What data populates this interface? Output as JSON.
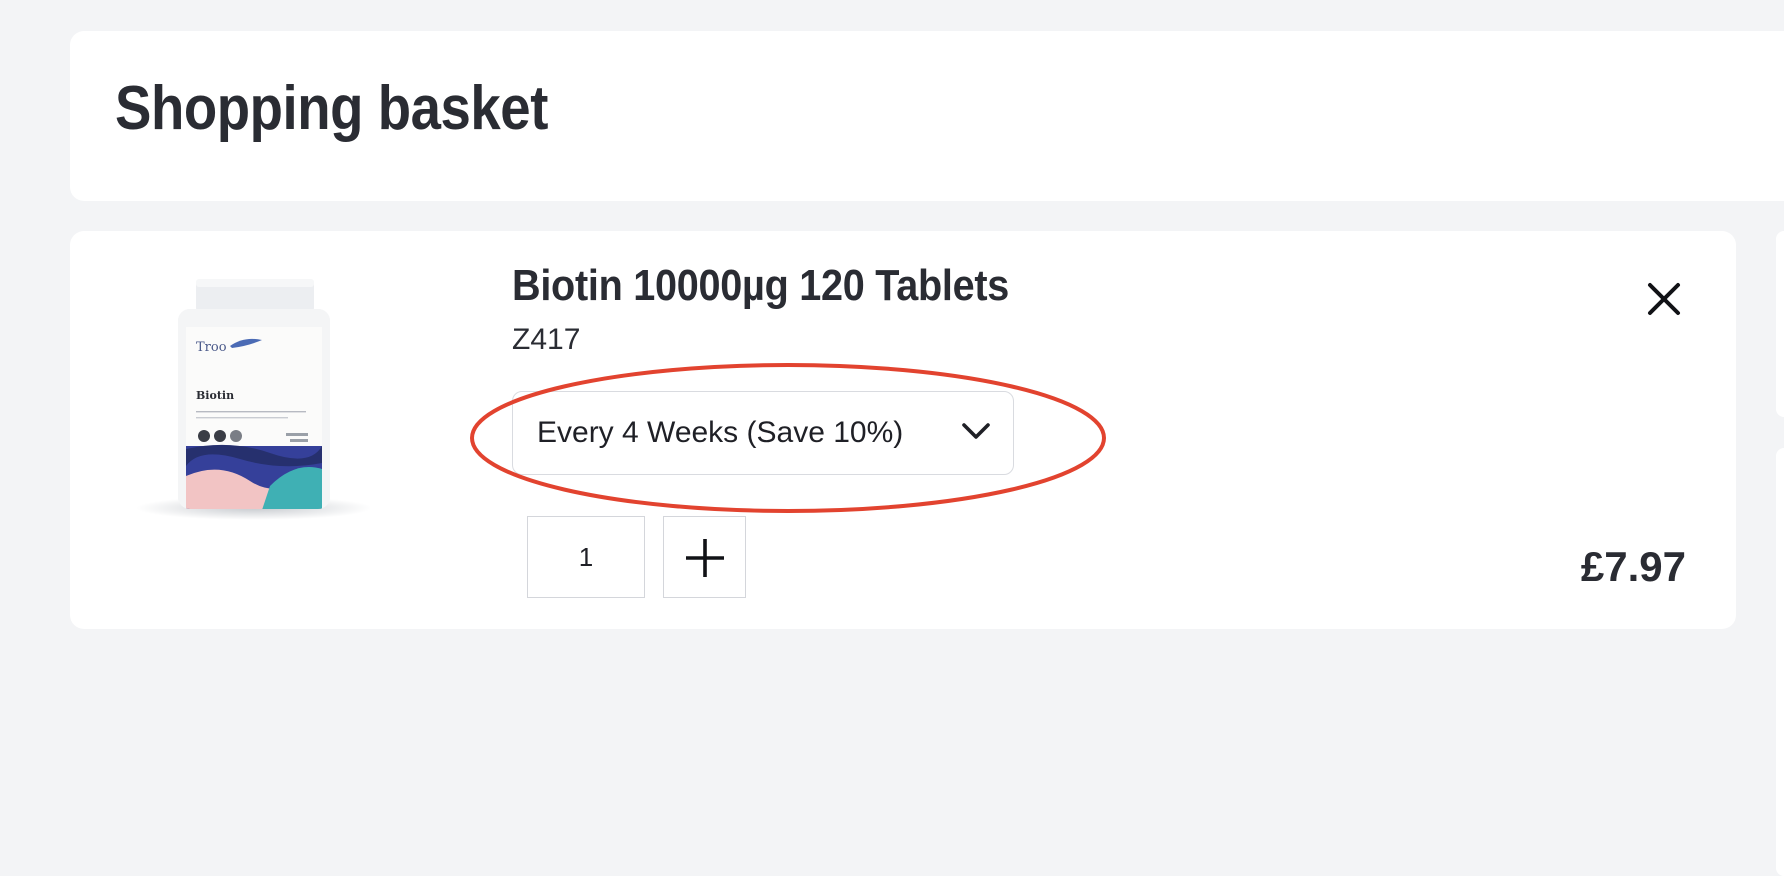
{
  "header": {
    "title": "Shopping basket"
  },
  "basket_item": {
    "name": "Biotin 10000µg 120 Tablets",
    "sku": "Z417",
    "frequency": "Every 4 Weeks (Save 10%)",
    "quantity": "1",
    "price": "£7.97",
    "image": {
      "brand_text": "Troo",
      "product_text": "Biotin"
    }
  },
  "icons": {
    "remove": "close-icon",
    "dropdown": "chevron-down-icon",
    "increment": "plus-icon"
  },
  "colors": {
    "background": "#f3f4f6",
    "card": "#ffffff",
    "text": "#2a2c33",
    "highlight_annotation": "#e2432f"
  }
}
